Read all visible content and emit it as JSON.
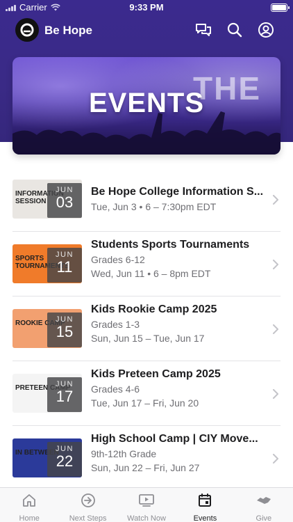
{
  "status_bar": {
    "carrier": "Carrier",
    "time": "9:33 PM"
  },
  "header": {
    "title": "Be Hope",
    "icons": [
      "chat-icon",
      "search-icon",
      "profile-icon"
    ]
  },
  "banner": {
    "title": "EVENTS",
    "background_word": "THE"
  },
  "events": [
    {
      "title": "Be Hope College Information S...",
      "lines": [
        "Tue, Jun 3 • 6 – 7:30pm EDT"
      ],
      "badge_month": "JUN",
      "badge_day": "03",
      "thumb_text": "INFORMATION SESSION",
      "thumb_color": "#e9e6e2"
    },
    {
      "title": "Students Sports Tournaments",
      "lines": [
        "Grades 6-12",
        "Wed, Jun 11 • 6 – 8pm EDT"
      ],
      "badge_month": "JUN",
      "badge_day": "11",
      "thumb_text": "SPORTS TOURNAMENTS",
      "thumb_color": "#f07b2a"
    },
    {
      "title": "Kids Rookie Camp 2025",
      "lines": [
        "Grades 1-3",
        "Sun, Jun 15 – Tue, Jun 17"
      ],
      "badge_month": "JUN",
      "badge_day": "15",
      "thumb_text": "ROOKIE CAMP",
      "thumb_color": "#f2a070"
    },
    {
      "title": "Kids Preteen Camp 2025",
      "lines": [
        "Grades 4-6",
        "Tue, Jun 17 – Fri, Jun 20"
      ],
      "badge_month": "JUN",
      "badge_day": "17",
      "thumb_text": "PRETEEN CAMP",
      "thumb_color": "#f4f4f4"
    },
    {
      "title": "High School Camp | CIY Move...",
      "lines": [
        "9th-12th Grade",
        "Sun, Jun 22 – Fri, Jun 27"
      ],
      "badge_month": "JUN",
      "badge_day": "22",
      "thumb_text": "IN BETWEEN",
      "thumb_color": "#2b3a9a"
    }
  ],
  "tabs": [
    {
      "label": "Home",
      "icon": "home-icon",
      "active": false
    },
    {
      "label": "Next Steps",
      "icon": "arrow-circle-icon",
      "active": false
    },
    {
      "label": "Watch Now",
      "icon": "play-screen-icon",
      "active": false
    },
    {
      "label": "Events",
      "icon": "calendar-icon",
      "active": true
    },
    {
      "label": "Give",
      "icon": "handshake-icon",
      "active": false
    }
  ],
  "colors": {
    "header_purple": "#3b2a8e",
    "accent_dark": "#1c1c1e",
    "muted": "#8e8e93"
  }
}
